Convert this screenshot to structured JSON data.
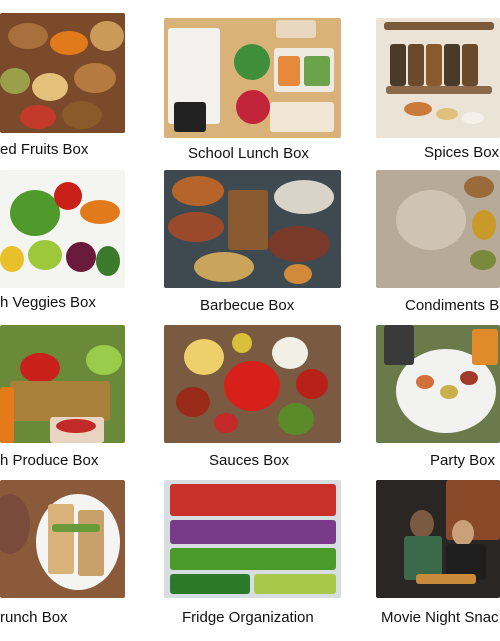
{
  "tiles": [
    {
      "caption": "ed Fruits Box"
    },
    {
      "caption": "School Lunch Box"
    },
    {
      "caption": "Spices Box"
    },
    {
      "caption": "h Veggies Box"
    },
    {
      "caption": "Barbecue Box"
    },
    {
      "caption": "Condiments B"
    },
    {
      "caption": "h Produce Box"
    },
    {
      "caption": "Sauces Box"
    },
    {
      "caption": "Party Box"
    },
    {
      "caption": "runch Box"
    },
    {
      "caption": "Fridge Organization"
    },
    {
      "caption": "Movie Night Snac"
    }
  ]
}
